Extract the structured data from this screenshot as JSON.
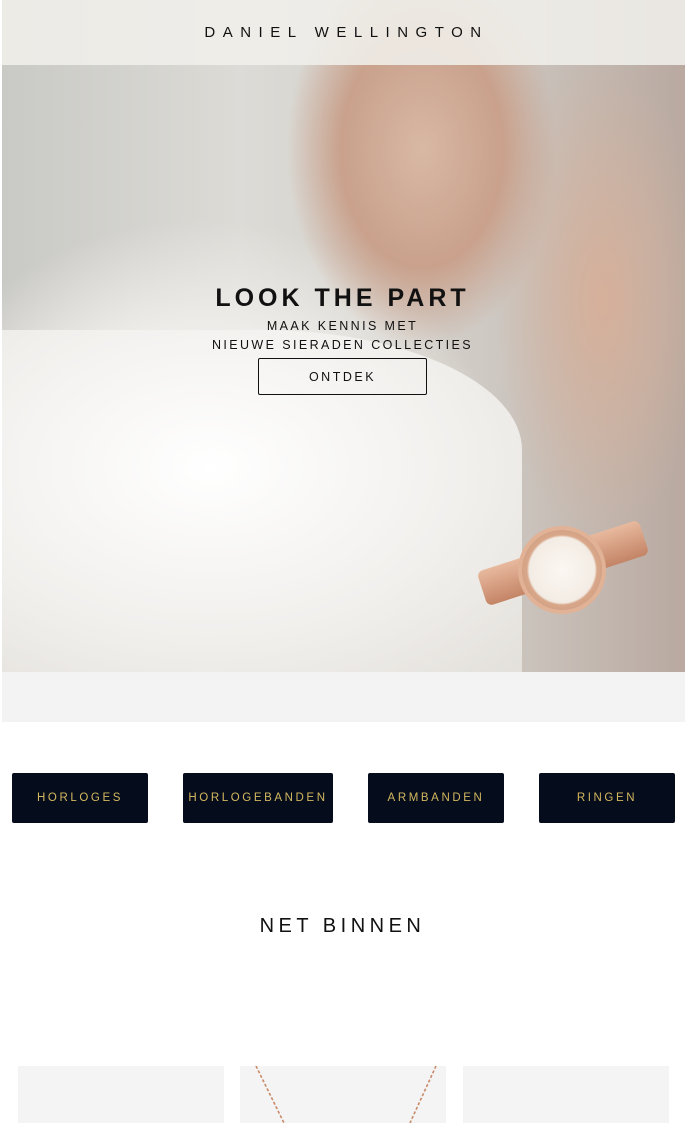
{
  "header": {
    "brand": "DANIEL WELLINGTON"
  },
  "hero": {
    "title": "LOOK THE PART",
    "subtitle_line1": "MAAK KENNIS MET",
    "subtitle_line2": "NIEUWE SIERADEN COLLECTIES",
    "cta": "ONTDEK"
  },
  "categories": [
    {
      "label": "HORLOGES"
    },
    {
      "label": "HORLOGEBANDEN"
    },
    {
      "label": "ARMBANDEN"
    },
    {
      "label": "RINGEN"
    }
  ],
  "new_in": {
    "title": "NET BINNEN"
  },
  "products": [
    {
      "image": "product-image"
    },
    {
      "image": "necklace-image"
    },
    {
      "image": "product-image"
    }
  ],
  "colors": {
    "category_bg": "#050d1c",
    "category_text": "#d4b75f",
    "header_bg": "#f0efeb"
  }
}
